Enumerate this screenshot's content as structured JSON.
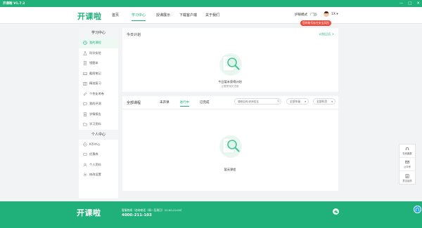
{
  "titlebar": {
    "title": "开课啦 V1.7.2",
    "minimize": "—",
    "maximize": "□",
    "close": "✕"
  },
  "nav": {
    "logo": "开课啦",
    "items": [
      "首页",
      "学习中心",
      "授课展示",
      "下载客户端",
      "关于我们"
    ],
    "active": "学习中心",
    "eye_mode_label": "护眼模式",
    "user_name": "1X",
    "bind_tip": "您的账号存在安全风险"
  },
  "sidebar": {
    "study_header": "学习中心",
    "study_items": [
      "我的课程",
      "科学实验",
      "错题本",
      "截图笔记",
      "精准复习",
      "个性化考卷",
      "我的评测",
      "学情报告",
      "学习资料"
    ],
    "active": "我的课程",
    "personal_header": "个人中心",
    "personal_items": [
      "K币中心",
      "优惠券",
      "个人资料",
      "修改设置"
    ]
  },
  "today_plan": {
    "title": "今日计划",
    "link": "计划日历 >",
    "empty_text": "今日暂未获得计划",
    "empty_sub": "主要是相关进度"
  },
  "all_courses": {
    "title": "全部课程",
    "tabs": [
      "未开课",
      "进行中",
      "已完成"
    ],
    "active_tab": "进行中",
    "search_placeholder": "课程名称/老师姓名",
    "select_grade": "全部年级",
    "select_subject": "全部科目",
    "empty_text": "暂无课程"
  },
  "float_tools": {
    "items": [
      "在线客服",
      "公众号",
      "意见反馈"
    ]
  },
  "footer": {
    "logo": "开课啦",
    "line1": "客服热线（咨询电话（周一至周日）12:00-22:00）",
    "phone": "4000-211-103"
  },
  "colors": {
    "brand": "#20b07a",
    "warning": "#f04b3f"
  }
}
